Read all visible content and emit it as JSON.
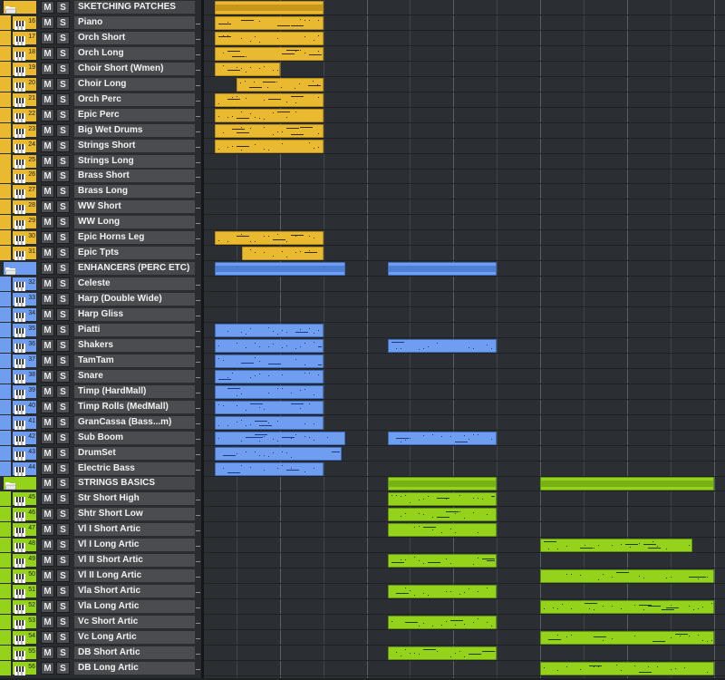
{
  "colors": {
    "yellow": "#e9b92f",
    "blue": "#6f9ef0",
    "green": "#94d21b"
  },
  "buttons": {
    "mute": "M",
    "solo": "S"
  },
  "tracks": [
    {
      "name": "SKETCHING PATCHES",
      "num": "",
      "folder": true,
      "color": "yellow",
      "clips": [
        [
          12,
          132
        ]
      ]
    },
    {
      "name": "Piano",
      "num": "16",
      "folder": false,
      "color": "yellow",
      "clips": [
        [
          12,
          132
        ]
      ]
    },
    {
      "name": "Orch Short",
      "num": "17",
      "folder": false,
      "color": "yellow",
      "clips": [
        [
          12,
          132
        ]
      ]
    },
    {
      "name": "Orch Long",
      "num": "18",
      "folder": false,
      "color": "yellow",
      "clips": [
        [
          12,
          132
        ]
      ]
    },
    {
      "name": "Choir Short (Wmen)",
      "num": "19",
      "folder": false,
      "color": "yellow",
      "clips": [
        [
          12,
          84
        ]
      ]
    },
    {
      "name": "Choir Long",
      "num": "20",
      "folder": false,
      "color": "yellow",
      "clips": [
        [
          36,
          132
        ]
      ]
    },
    {
      "name": "Orch Perc",
      "num": "21",
      "folder": false,
      "color": "yellow",
      "clips": [
        [
          12,
          132
        ]
      ]
    },
    {
      "name": "Epic Perc",
      "num": "22",
      "folder": false,
      "color": "yellow",
      "clips": [
        [
          12,
          132
        ]
      ]
    },
    {
      "name": "Big Wet Drums",
      "num": "23",
      "folder": false,
      "color": "yellow",
      "clips": [
        [
          12,
          132
        ]
      ]
    },
    {
      "name": "Strings Short",
      "num": "24",
      "folder": false,
      "color": "yellow",
      "clips": [
        [
          12,
          132
        ]
      ]
    },
    {
      "name": "Strings Long",
      "num": "25",
      "folder": false,
      "color": "yellow",
      "clips": []
    },
    {
      "name": "Brass Short",
      "num": "26",
      "folder": false,
      "color": "yellow",
      "clips": []
    },
    {
      "name": "Brass Long",
      "num": "27",
      "folder": false,
      "color": "yellow",
      "clips": []
    },
    {
      "name": "WW Short",
      "num": "28",
      "folder": false,
      "color": "yellow",
      "clips": []
    },
    {
      "name": "WW Long",
      "num": "29",
      "folder": false,
      "color": "yellow",
      "clips": []
    },
    {
      "name": "Epic Horns Leg",
      "num": "30",
      "folder": false,
      "color": "yellow",
      "clips": [
        [
          12,
          132
        ]
      ]
    },
    {
      "name": "Epic Tpts",
      "num": "31",
      "folder": false,
      "color": "yellow",
      "clips": [
        [
          42,
          132
        ]
      ]
    },
    {
      "name": "ENHANCERS (PERC ETC)",
      "num": "",
      "folder": true,
      "color": "blue",
      "clips": [
        [
          12,
          156
        ],
        [
          203,
          323
        ]
      ]
    },
    {
      "name": "Celeste",
      "num": "32",
      "folder": false,
      "color": "blue",
      "clips": []
    },
    {
      "name": "Harp (Double Wide)",
      "num": "33",
      "folder": false,
      "color": "blue",
      "clips": []
    },
    {
      "name": "Harp Gliss",
      "num": "34",
      "folder": false,
      "color": "blue",
      "clips": []
    },
    {
      "name": "Piatti",
      "num": "35",
      "folder": false,
      "color": "blue",
      "clips": [
        [
          12,
          132
        ]
      ]
    },
    {
      "name": "Shakers",
      "num": "36",
      "folder": false,
      "color": "blue",
      "clips": [
        [
          12,
          132
        ],
        [
          203,
          323
        ]
      ]
    },
    {
      "name": "TamTam",
      "num": "37",
      "folder": false,
      "color": "blue",
      "clips": [
        [
          12,
          132
        ]
      ]
    },
    {
      "name": "Snare",
      "num": "38",
      "folder": false,
      "color": "blue",
      "clips": [
        [
          12,
          132
        ]
      ]
    },
    {
      "name": "Timp (HardMall)",
      "num": "39",
      "folder": false,
      "color": "blue",
      "clips": [
        [
          12,
          132
        ]
      ]
    },
    {
      "name": "Timp Rolls (MedMall)",
      "num": "40",
      "folder": false,
      "color": "blue",
      "clips": [
        [
          12,
          132
        ]
      ]
    },
    {
      "name": "GranCassa (Bass...m)",
      "num": "41",
      "folder": false,
      "color": "blue",
      "clips": [
        [
          12,
          132
        ]
      ]
    },
    {
      "name": "Sub Boom",
      "num": "42",
      "folder": false,
      "color": "blue",
      "clips": [
        [
          12,
          156
        ],
        [
          203,
          323
        ]
      ]
    },
    {
      "name": "DrumSet",
      "num": "43",
      "folder": false,
      "color": "blue",
      "clips": [
        [
          12,
          152
        ]
      ]
    },
    {
      "name": "Electric Bass",
      "num": "44",
      "folder": false,
      "color": "blue",
      "clips": [
        [
          12,
          132
        ]
      ]
    },
    {
      "name": "STRINGS BASICS",
      "num": "",
      "folder": true,
      "color": "green",
      "clips": [
        [
          203,
          323
        ],
        [
          371,
          563
        ]
      ]
    },
    {
      "name": "Str Short High",
      "num": "45",
      "folder": false,
      "color": "green",
      "clips": [
        [
          203,
          323
        ]
      ]
    },
    {
      "name": "Shtr Short Low",
      "num": "46",
      "folder": false,
      "color": "green",
      "clips": [
        [
          203,
          323
        ]
      ]
    },
    {
      "name": "Vl I Short Artic",
      "num": "47",
      "folder": false,
      "color": "green",
      "clips": [
        [
          203,
          323
        ]
      ]
    },
    {
      "name": "Vl I Long Artic",
      "num": "48",
      "folder": false,
      "color": "green",
      "clips": [
        [
          371,
          539
        ]
      ]
    },
    {
      "name": "Vl II Short Artic",
      "num": "49",
      "folder": false,
      "color": "green",
      "clips": [
        [
          203,
          323
        ]
      ]
    },
    {
      "name": "Vl II Long Artic",
      "num": "50",
      "folder": false,
      "color": "green",
      "clips": [
        [
          371,
          563
        ]
      ]
    },
    {
      "name": "Vla Short Artic",
      "num": "51",
      "folder": false,
      "color": "green",
      "clips": [
        [
          203,
          323
        ]
      ]
    },
    {
      "name": "Vla Long Artic",
      "num": "52",
      "folder": false,
      "color": "green",
      "clips": [
        [
          371,
          563
        ]
      ]
    },
    {
      "name": "Vc Short Artic",
      "num": "53",
      "folder": false,
      "color": "green",
      "clips": [
        [
          203,
          323
        ]
      ]
    },
    {
      "name": "Vc Long Artic",
      "num": "54",
      "folder": false,
      "color": "green",
      "clips": [
        [
          371,
          563
        ]
      ]
    },
    {
      "name": "DB Short Artic",
      "num": "55",
      "folder": false,
      "color": "green",
      "clips": [
        [
          203,
          323
        ]
      ]
    },
    {
      "name": "DB Long Artic",
      "num": "56",
      "folder": false,
      "color": "green",
      "clips": [
        [
          371,
          563
        ]
      ]
    }
  ]
}
